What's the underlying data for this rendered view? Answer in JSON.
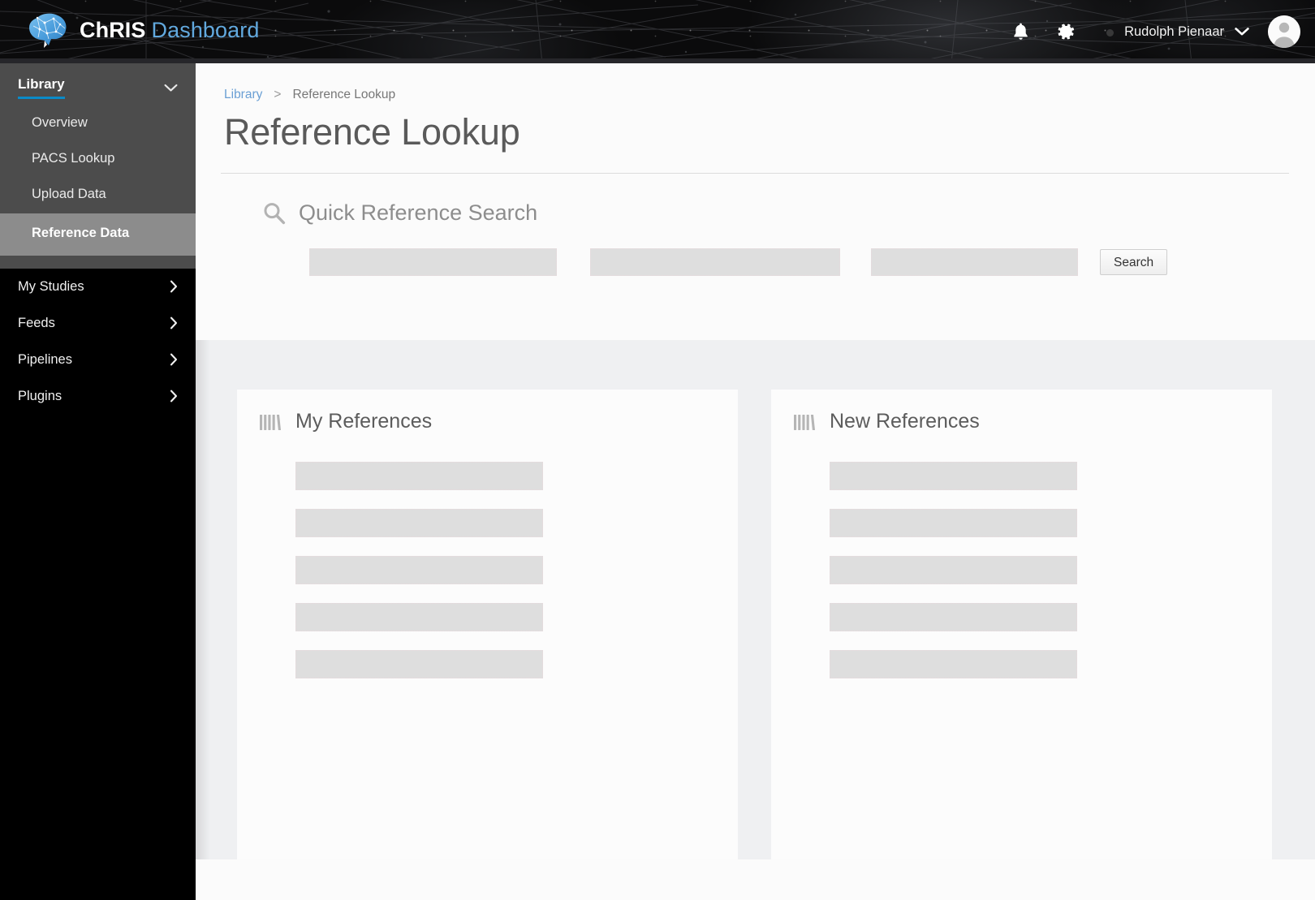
{
  "app": {
    "brand_primary": "ChRIS",
    "brand_secondary": "Dashboard",
    "accent_blue": "#0a8bc8",
    "brand_blue": "#62a9de",
    "header_bg": "#0b0b0c"
  },
  "header": {
    "notifications_icon": "bell-icon",
    "settings_icon": "gear-icon",
    "user_name": "Rudolph Pienaar",
    "user_menu_icon": "chevron-down-icon",
    "avatar_icon": "user-avatar-icon"
  },
  "sidebar": {
    "groups": [
      {
        "label": "Library",
        "expanded": true,
        "toggle_icon": "chevron-down-icon",
        "items": [
          {
            "label": "Overview",
            "active": false
          },
          {
            "label": "PACS Lookup",
            "active": false
          },
          {
            "label": "Upload Data",
            "active": false
          },
          {
            "label": "Reference Data",
            "active": true
          }
        ]
      }
    ],
    "collapsed_items": [
      {
        "label": "My Studies",
        "icon": "chevron-right-icon"
      },
      {
        "label": "Feeds",
        "icon": "chevron-right-icon"
      },
      {
        "label": "Pipelines",
        "icon": "chevron-right-icon"
      },
      {
        "label": "Plugins",
        "icon": "chevron-right-icon"
      }
    ]
  },
  "breadcrumb": {
    "parent": "Library",
    "separator": ">",
    "current": "Reference Lookup"
  },
  "page": {
    "title": "Reference Lookup"
  },
  "search": {
    "icon": "search-icon",
    "label": "Quick Reference Search",
    "fields": [
      {
        "name": "field-1",
        "value": "",
        "placeholder": ""
      },
      {
        "name": "field-2",
        "value": "",
        "placeholder": ""
      },
      {
        "name": "field-3",
        "value": "",
        "placeholder": ""
      }
    ],
    "button_label": "Search"
  },
  "cards": [
    {
      "icon": "books-shelf-icon",
      "title": "My References",
      "rows": [
        "",
        "",
        "",
        "",
        ""
      ]
    },
    {
      "icon": "books-shelf-icon",
      "title": "New References",
      "rows": [
        "",
        "",
        "",
        "",
        ""
      ]
    }
  ]
}
